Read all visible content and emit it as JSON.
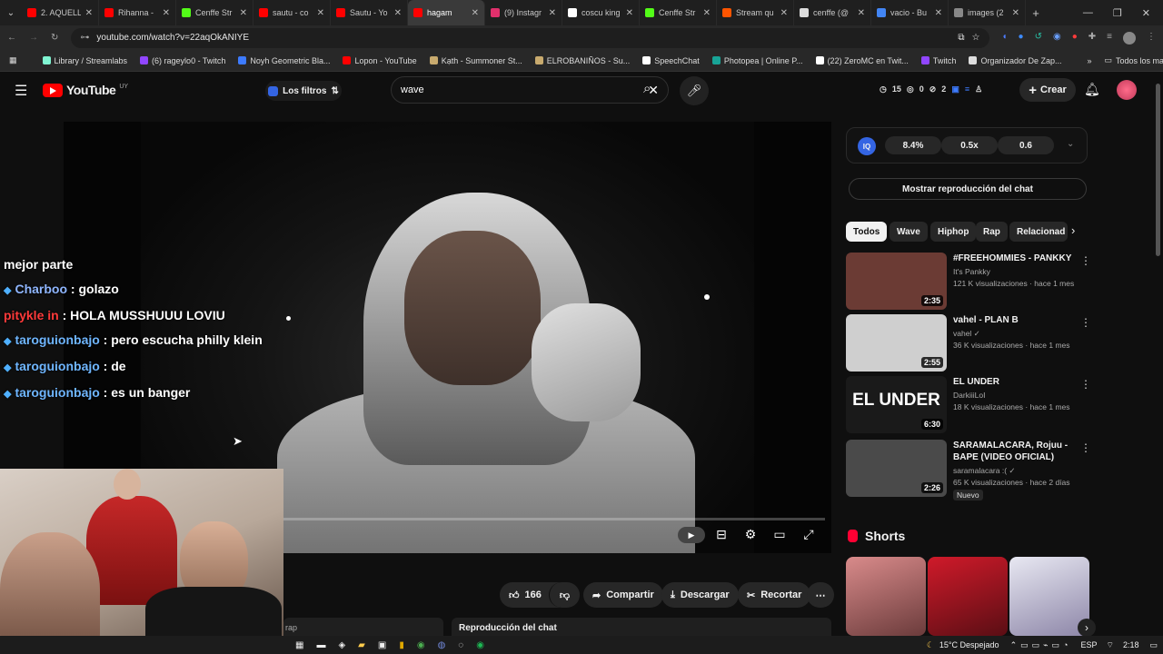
{
  "browser": {
    "tabs": [
      {
        "label": "2. AQUELL",
        "color": "#ff0000"
      },
      {
        "label": "Rihanna -",
        "color": "#ff0000"
      },
      {
        "label": "Cenffe Str",
        "color": "#53fc18"
      },
      {
        "label": "sautu - co",
        "color": "#ff0000"
      },
      {
        "label": "Sautu - Yo",
        "color": "#ff0000"
      },
      {
        "label": "hagam",
        "color": "#ff0000"
      },
      {
        "label": "(9) Instagr",
        "color": "#e1306c"
      },
      {
        "label": "coscu king",
        "color": "#ffffff"
      },
      {
        "label": "Cenffe Str",
        "color": "#53fc18"
      },
      {
        "label": "Stream qu",
        "color": "#ff5500"
      },
      {
        "label": "cenffe (@",
        "color": "#dddddd"
      },
      {
        "label": "vacio - Bu",
        "color": "#4285f4"
      },
      {
        "label": "images (2",
        "color": "#888888"
      }
    ],
    "url": "youtube.com/watch?v=22aqOkANIYE",
    "bookmarks": [
      {
        "label": "Library / Streamlabs",
        "color": "#80f5d2"
      },
      {
        "label": "(6) rageylo0 - Twitch",
        "color": "#9146ff"
      },
      {
        "label": "Noyh Geometric Bla...",
        "color": "#3d7bff"
      },
      {
        "label": "Lopon - YouTube",
        "color": "#ff0000"
      },
      {
        "label": "Kạth - Summoner St...",
        "color": "#c8aa6e"
      },
      {
        "label": "ELROBANIÑOS - Su...",
        "color": "#c8aa6e"
      },
      {
        "label": "SpeechChat",
        "color": "#ffffff"
      },
      {
        "label": "Photopea | Online P...",
        "color": "#18a497"
      },
      {
        "label": "(22) ZeroMC en Twit...",
        "color": "#ffffff"
      },
      {
        "label": "Twitch",
        "color": "#9146ff"
      },
      {
        "label": "Organizador De Zap...",
        "color": "#dddddd"
      }
    ],
    "all_bookmarks": "Todos los marcadores"
  },
  "header": {
    "logo": "YouTube",
    "country": "UY",
    "filters": "Los filtros",
    "search_value": "wave",
    "counts": [
      "15",
      "0",
      "2"
    ],
    "create": "Crear"
  },
  "speed": {
    "values": [
      "8.4%",
      "0.5x",
      "0.6"
    ]
  },
  "chat_replay_btn": "Mostrar reproducción del chat",
  "chips": [
    "Todos",
    "Wave",
    "Hiphop",
    "Rap",
    "Relacionad"
  ],
  "related": [
    {
      "title": "#FREEHOMMIES - PANKKY",
      "channel": "It's Pankky",
      "meta": "121 K visualizaciones · hace 1 mes",
      "duration": "2:35",
      "bg": "#6b3b34"
    },
    {
      "title": "vahel - PLAN B",
      "channel": "vahel ✓",
      "meta": "36 K visualizaciones · hace 1 mes",
      "duration": "2:55",
      "bg": "#cfcfcf"
    },
    {
      "title": "EL UNDER",
      "channel": "DarkiiiLoI",
      "meta": "18 K visualizaciones · hace 1 mes",
      "duration": "6:30",
      "bg": "#1a1a1a",
      "overlay": "EL UNDER"
    },
    {
      "title": "SARAMALACARA, Rojuu - BAPE (VIDEO OFICIAL)",
      "channel": "saramalacara :( ✓",
      "meta": "65 K visualizaciones · hace 2 días",
      "duration": "2:26",
      "bg": "#4a4a4a",
      "badge": "Nuevo"
    }
  ],
  "shorts": {
    "label": "Shorts"
  },
  "actions": {
    "likes": "166",
    "share": "Compartir",
    "download": "Descargar",
    "clip": "Recortar"
  },
  "chat_replay_bar": "Reproducción del chat",
  "chat_bar_left": "rap",
  "chat": [
    {
      "user": "",
      "text": "mejor parte"
    },
    {
      "user": "Charboo",
      "text": " : golazo",
      "ucolor": "#8fb6ff",
      "badge": "🟦"
    },
    {
      "user": "pitykle in",
      "text": " : HOLA MUSSHUUU LOVIU",
      "ucolor": "#ff3a3a"
    },
    {
      "user": "taroguionbajo",
      "text": " : pero escucha philly klein",
      "ucolor": "#6fb6ff",
      "badge": "🧊"
    },
    {
      "user": "taroguionbajo",
      "text": " : de",
      "ucolor": "#6fb6ff",
      "badge": "🧊"
    },
    {
      "user": "taroguionbajo",
      "text": " : es un banger",
      "ucolor": "#6fb6ff",
      "badge": "🧊"
    }
  ],
  "taskbar": {
    "weather": "15°C Despejado",
    "lang": "ESP",
    "time": "2:18"
  }
}
